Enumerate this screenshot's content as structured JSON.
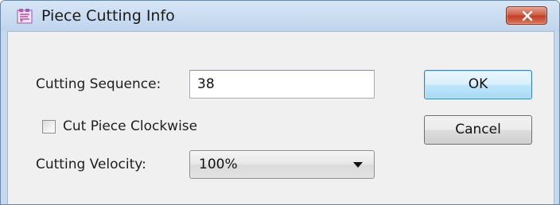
{
  "window": {
    "title": "Piece Cutting Info",
    "icon": "app-icon",
    "close_icon": "close-icon"
  },
  "form": {
    "sequence_label": "Cutting Sequence:",
    "sequence_value": "38",
    "clockwise_label": "Cut Piece Clockwise",
    "clockwise_checked": false,
    "velocity_label": "Cutting Velocity:",
    "velocity_value": "100%"
  },
  "buttons": {
    "ok_label": "OK",
    "cancel_label": "Cancel"
  },
  "colors": {
    "frame": "#c4d9ef",
    "client": "#f0f0f0",
    "close_button": "#c94f37",
    "default_button_border": "#3c7fb1"
  }
}
